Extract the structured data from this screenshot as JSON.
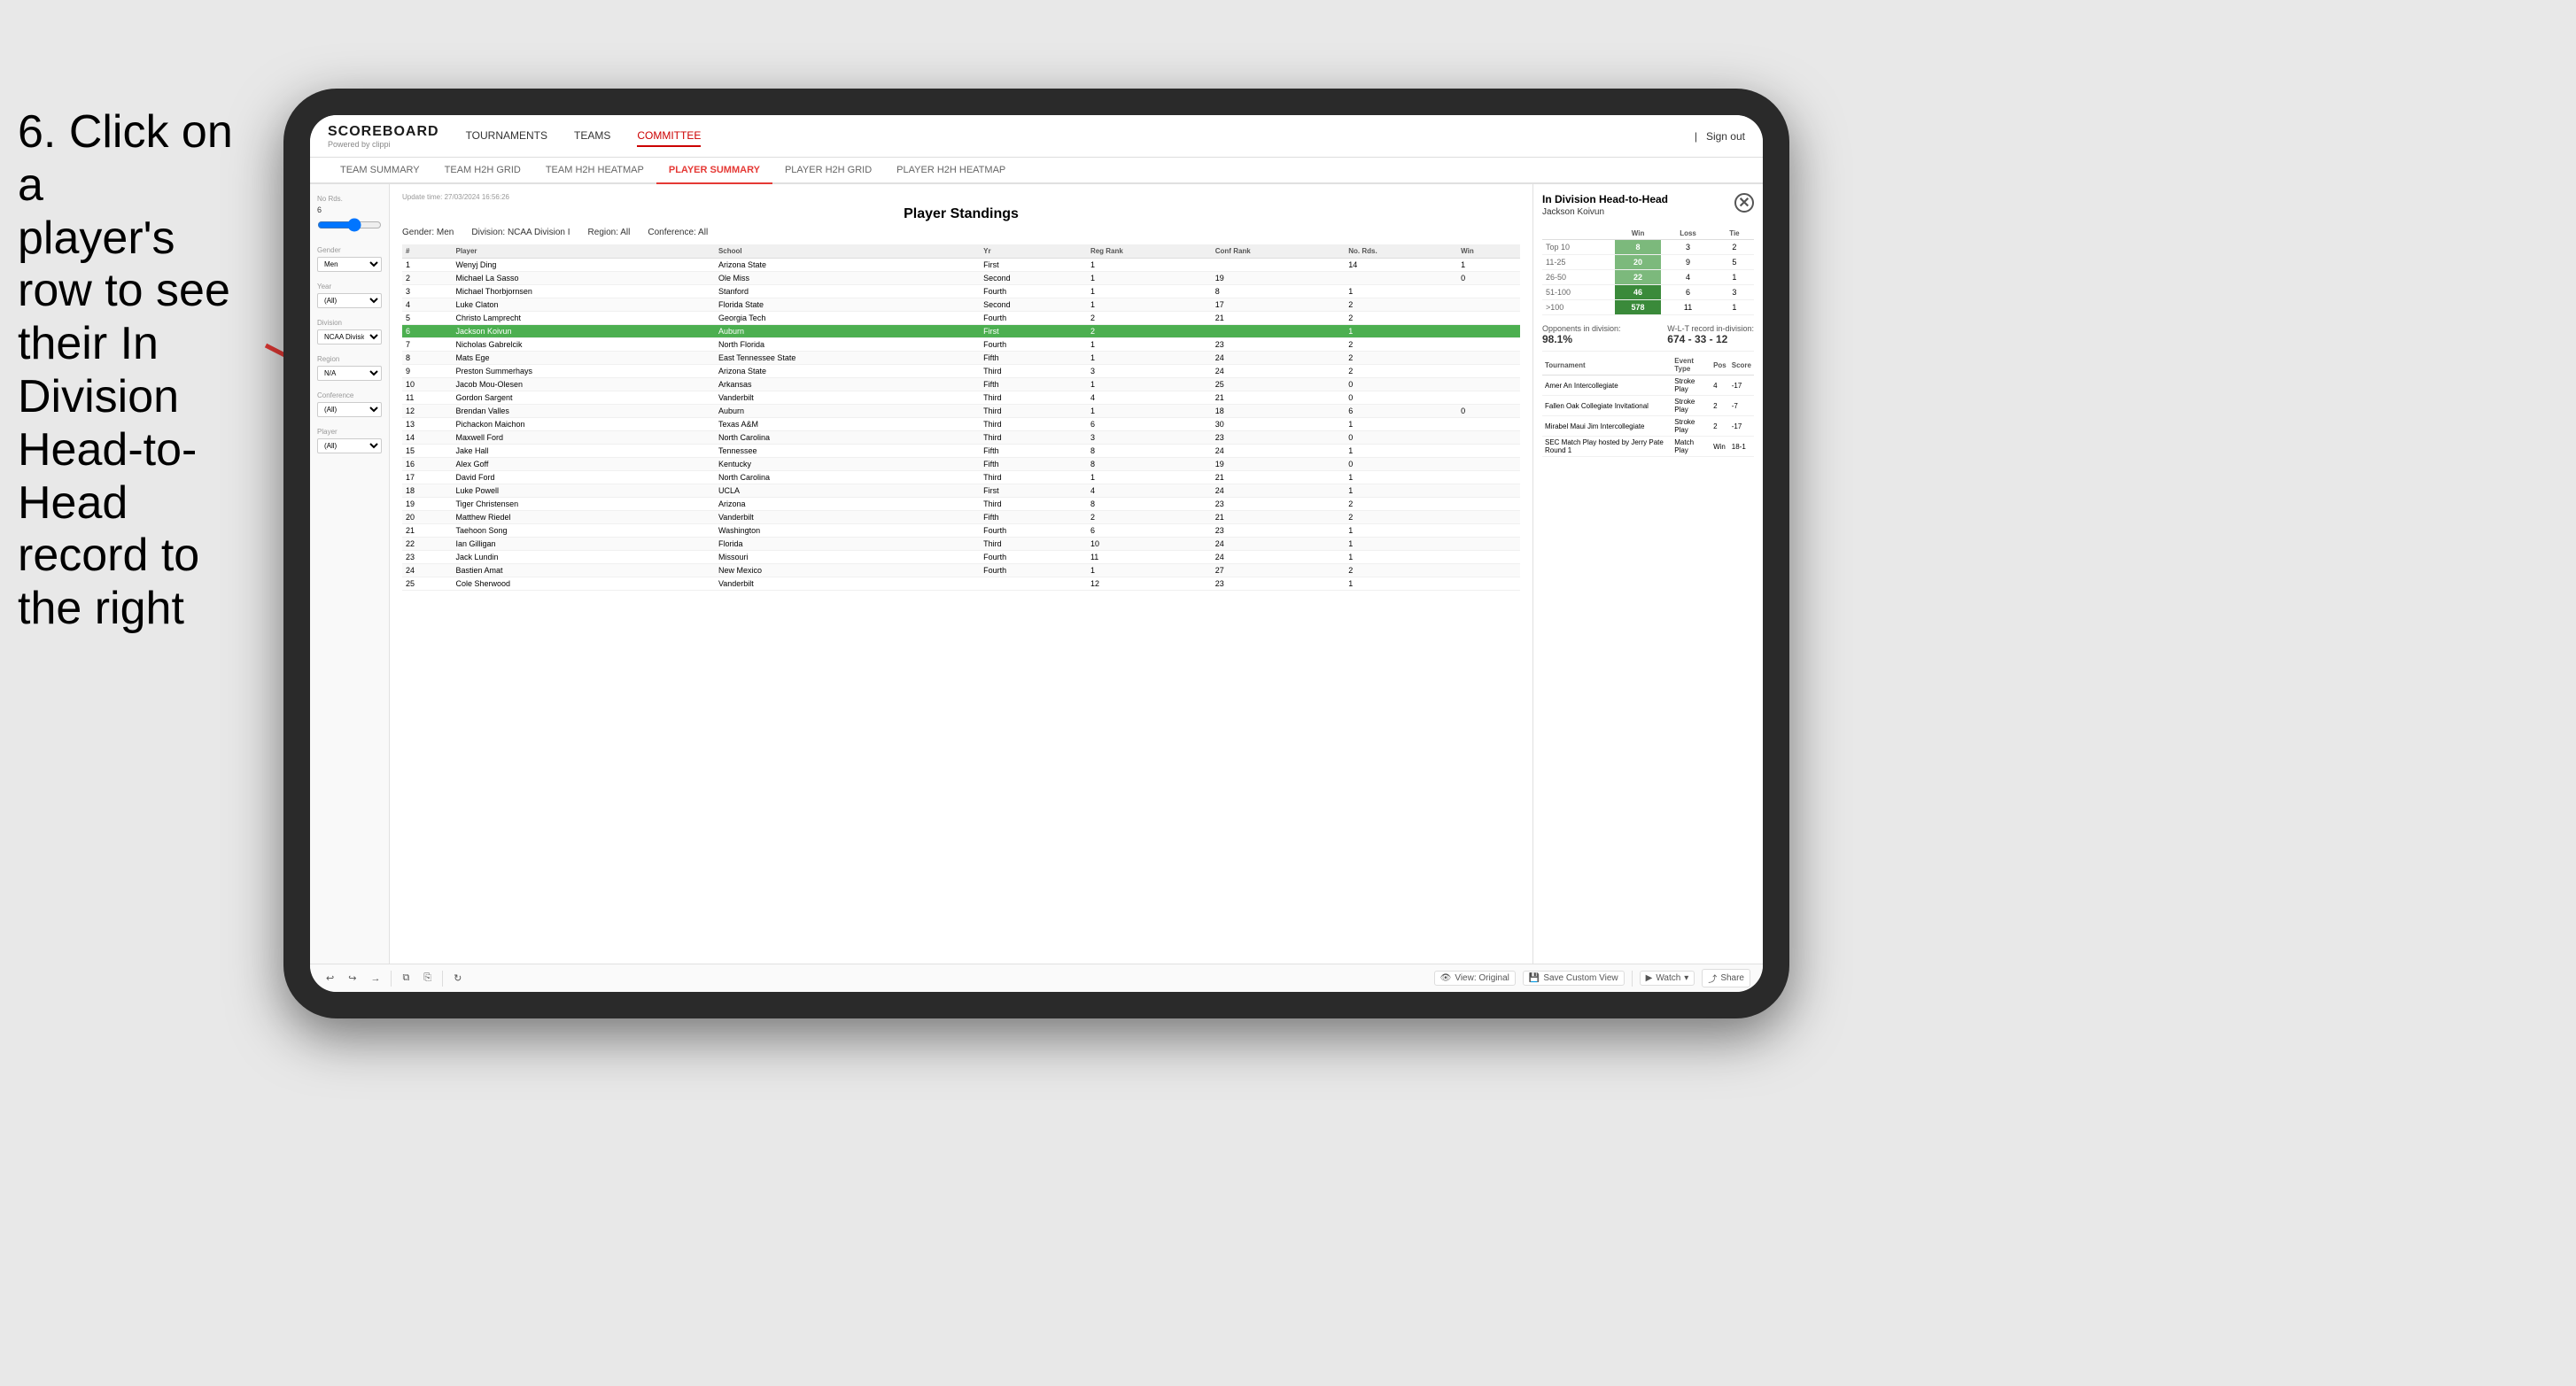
{
  "instruction": {
    "line1": "6. Click on a",
    "line2": "player's row to see",
    "line3": "their In Division",
    "line4": "Head-to-Head",
    "line5": "record to the right"
  },
  "nav": {
    "logo": "SCOREBOARD",
    "logo_sub": "Powered by clippi",
    "links": [
      "TOURNAMENTS",
      "TEAMS",
      "COMMITTEE"
    ],
    "sign_out": "Sign out"
  },
  "sub_nav": {
    "items": [
      "TEAM SUMMARY",
      "TEAM H2H GRID",
      "TEAM H2H HEATMAP",
      "PLAYER SUMMARY",
      "PLAYER H2H GRID",
      "PLAYER H2H HEATMAP"
    ]
  },
  "sidebar": {
    "no_rds_label": "No Rds.",
    "no_rds_value": "6",
    "gender_label": "Gender",
    "gender_value": "Men",
    "year_label": "Year",
    "year_value": "(All)",
    "division_label": "Division",
    "division_value": "NCAA Division I",
    "region_label": "Region",
    "region_value": "N/A",
    "conference_label": "Conference",
    "conference_value": "(All)",
    "player_label": "Player",
    "player_value": "(All)"
  },
  "panel": {
    "update_time": "Update time: 27/03/2024 16:56:26",
    "title": "Player Standings",
    "filters": {
      "gender": "Gender: Men",
      "division": "Division: NCAA Division I",
      "region": "Region: All",
      "conference": "Conference: All"
    },
    "table_headers": [
      "#",
      "Player",
      "School",
      "Yr",
      "Reg Rank",
      "Conf Rank",
      "No. Rds.",
      "Win"
    ],
    "rows": [
      {
        "num": 1,
        "player": "Wenyj Ding",
        "school": "Arizona State",
        "yr": "First",
        "reg": 1,
        "conf": "",
        "rds": 14,
        "win": 1
      },
      {
        "num": 2,
        "player": "Michael La Sasso",
        "school": "Ole Miss",
        "yr": "Second",
        "reg": 1,
        "conf": 19,
        "rds": "",
        "win": 0
      },
      {
        "num": 3,
        "player": "Michael Thorbjornsen",
        "school": "Stanford",
        "yr": "Fourth",
        "reg": 1,
        "conf": 8,
        "rds": 1,
        "win": ""
      },
      {
        "num": 4,
        "player": "Luke Claton",
        "school": "Florida State",
        "yr": "Second",
        "reg": 1,
        "conf": 17,
        "rds": 2,
        "win": ""
      },
      {
        "num": 5,
        "player": "Christo Lamprecht",
        "school": "Georgia Tech",
        "yr": "Fourth",
        "reg": 2,
        "conf": 21,
        "rds": 2,
        "win": ""
      },
      {
        "num": 6,
        "player": "Jackson Koivun",
        "school": "Auburn",
        "yr": "First",
        "reg": 2,
        "conf": "",
        "rds": 1,
        "win": "",
        "highlighted": true
      },
      {
        "num": 7,
        "player": "Nicholas Gabrelcik",
        "school": "North Florida",
        "yr": "Fourth",
        "reg": 1,
        "conf": 23,
        "rds": 2,
        "win": ""
      },
      {
        "num": 8,
        "player": "Mats Ege",
        "school": "East Tennessee State",
        "yr": "Fifth",
        "reg": 1,
        "conf": 24,
        "rds": 2,
        "win": ""
      },
      {
        "num": 9,
        "player": "Preston Summerhays",
        "school": "Arizona State",
        "yr": "Third",
        "reg": 3,
        "conf": 24,
        "rds": 2,
        "win": ""
      },
      {
        "num": 10,
        "player": "Jacob Mou-Olesen",
        "school": "Arkansas",
        "yr": "Fifth",
        "reg": 1,
        "conf": 25,
        "rds": 0,
        "win": ""
      },
      {
        "num": 11,
        "player": "Gordon Sargent",
        "school": "Vanderbilt",
        "yr": "Third",
        "reg": 4,
        "conf": 21,
        "rds": 0,
        "win": ""
      },
      {
        "num": 12,
        "player": "Brendan Valles",
        "school": "Auburn",
        "yr": "Third",
        "reg": 1,
        "conf": 18,
        "rds": 6,
        "win": 0
      },
      {
        "num": 13,
        "player": "Pichackon Maichon",
        "school": "Texas A&M",
        "yr": "Third",
        "reg": 6,
        "conf": 30,
        "rds": 1,
        "win": ""
      },
      {
        "num": 14,
        "player": "Maxwell Ford",
        "school": "North Carolina",
        "yr": "Third",
        "reg": 3,
        "conf": 23,
        "rds": 0,
        "win": ""
      },
      {
        "num": 15,
        "player": "Jake Hall",
        "school": "Tennessee",
        "yr": "Fifth",
        "reg": 8,
        "conf": 24,
        "rds": 1,
        "win": ""
      },
      {
        "num": 16,
        "player": "Alex Goff",
        "school": "Kentucky",
        "yr": "Fifth",
        "reg": 8,
        "conf": 19,
        "rds": 0,
        "win": ""
      },
      {
        "num": 17,
        "player": "David Ford",
        "school": "North Carolina",
        "yr": "Third",
        "reg": 1,
        "conf": 21,
        "rds": 1,
        "win": ""
      },
      {
        "num": 18,
        "player": "Luke Powell",
        "school": "UCLA",
        "yr": "First",
        "reg": 4,
        "conf": 24,
        "rds": 1,
        "win": ""
      },
      {
        "num": 19,
        "player": "Tiger Christensen",
        "school": "Arizona",
        "yr": "Third",
        "reg": 8,
        "conf": 23,
        "rds": 2,
        "win": ""
      },
      {
        "num": 20,
        "player": "Matthew Riedel",
        "school": "Vanderbilt",
        "yr": "Fifth",
        "reg": 2,
        "conf": 21,
        "rds": 2,
        "win": ""
      },
      {
        "num": 21,
        "player": "Taehoon Song",
        "school": "Washington",
        "yr": "Fourth",
        "reg": 6,
        "conf": 23,
        "rds": 1,
        "win": ""
      },
      {
        "num": 22,
        "player": "Ian Gilligan",
        "school": "Florida",
        "yr": "Third",
        "reg": 10,
        "conf": 24,
        "rds": 1,
        "win": ""
      },
      {
        "num": 23,
        "player": "Jack Lundin",
        "school": "Missouri",
        "yr": "Fourth",
        "reg": 11,
        "conf": 24,
        "rds": 1,
        "win": ""
      },
      {
        "num": 24,
        "player": "Bastien Amat",
        "school": "New Mexico",
        "yr": "Fourth",
        "reg": 1,
        "conf": 27,
        "rds": 2,
        "win": ""
      },
      {
        "num": 25,
        "player": "Cole Sherwood",
        "school": "Vanderbilt",
        "yr": "",
        "reg": 12,
        "conf": 23,
        "rds": 1,
        "win": ""
      }
    ]
  },
  "right_panel": {
    "title": "In Division Head-to-Head",
    "player_name": "Jackson Koivun",
    "table_headers": [
      "",
      "Win",
      "Loss",
      "Tie"
    ],
    "rows": [
      {
        "range": "Top 10",
        "win": 8,
        "loss": 3,
        "tie": 2,
        "win_level": "medium"
      },
      {
        "range": "11-25",
        "win": 20,
        "loss": 9,
        "tie": 5,
        "win_level": "medium"
      },
      {
        "range": "26-50",
        "win": 22,
        "loss": 4,
        "tie": 1,
        "win_level": "medium"
      },
      {
        "range": "51-100",
        "win": 46,
        "loss": 6,
        "tie": 3,
        "win_level": "dark"
      },
      {
        "range": ">100",
        "win": 578,
        "loss": 11,
        "tie": 1,
        "win_level": "dark"
      }
    ],
    "opponents_label": "Opponents in division:",
    "opponents_pct": "98.1%",
    "wlt_label": "W-L-T record in-division:",
    "wlt_value": "674 - 33 - 12",
    "tournament_headers": [
      "Tournament",
      "Event Type",
      "Pos",
      "Score"
    ],
    "tournaments": [
      {
        "name": "Amer An Intercollegiate",
        "type": "Stroke Play",
        "pos": 4,
        "score": "-17"
      },
      {
        "name": "Fallen Oak Collegiate Invitational",
        "type": "Stroke Play",
        "pos": 2,
        "score": "-7"
      },
      {
        "name": "Mirabel Maui Jim Intercollegiate",
        "type": "Stroke Play",
        "pos": 2,
        "score": "-17"
      },
      {
        "name": "SEC Match Play hosted by Jerry Pate Round 1",
        "type": "Match Play",
        "pos": "Win",
        "score": "18-1"
      }
    ]
  },
  "toolbar": {
    "view_original": "View: Original",
    "save_custom": "Save Custom View",
    "watch": "Watch",
    "share": "Share"
  }
}
